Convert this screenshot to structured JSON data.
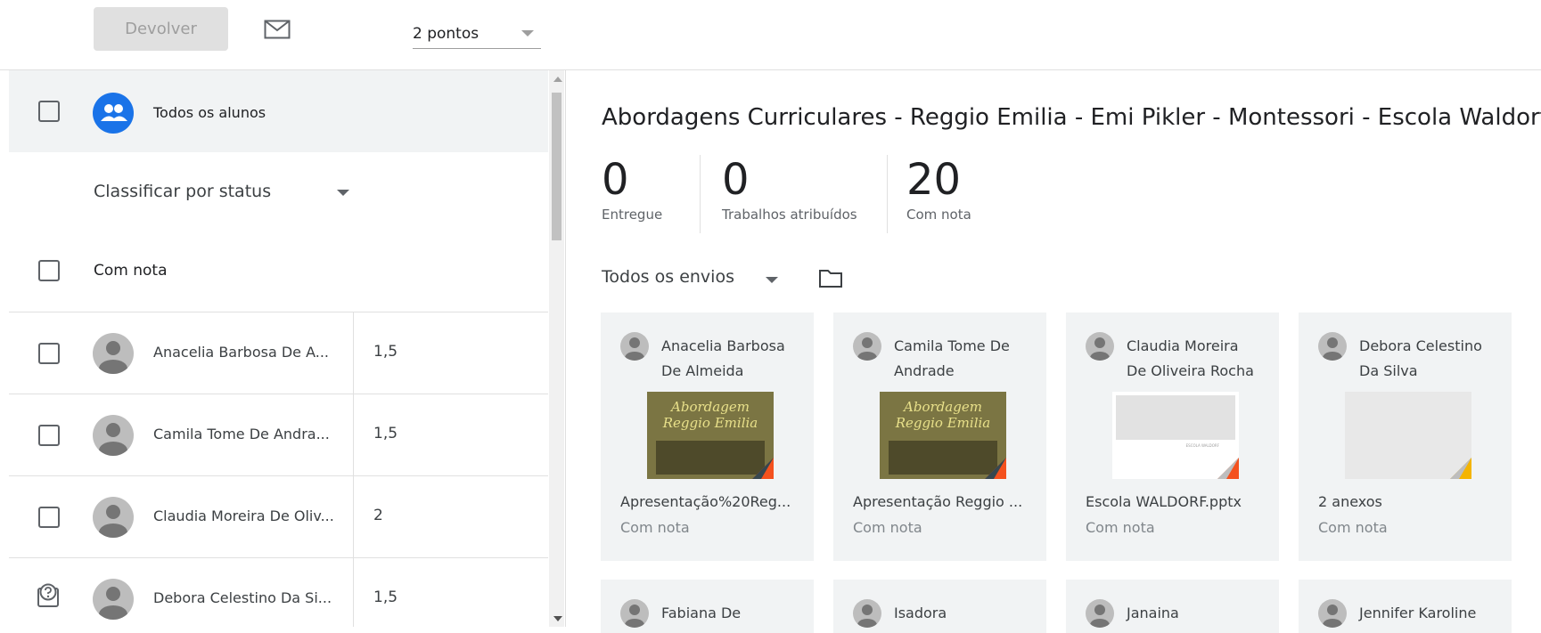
{
  "toolbar": {
    "return_label": "Devolver",
    "points_value": "2 pontos"
  },
  "left": {
    "all_students_label": "Todos os alunos",
    "sort_label": "Classificar por status",
    "group_label": "Com nota",
    "students": [
      {
        "name": "Anacelia Barbosa De A...",
        "grade": "1,5"
      },
      {
        "name": "Camila Tome De Andra...",
        "grade": "1,5"
      },
      {
        "name": "Claudia Moreira De Oliv...",
        "grade": "2"
      },
      {
        "name": "Debora Celestino Da Si...",
        "grade": "1,5"
      }
    ]
  },
  "right": {
    "title": "Abordagens Curriculares - Reggio Emilia - Emi Pikler - Montessori - Escola Waldorf",
    "stats": [
      {
        "value": "0",
        "label": "Entregue"
      },
      {
        "value": "0",
        "label": "Trabalhos atribuídos"
      },
      {
        "value": "20",
        "label": "Com nota"
      }
    ],
    "filter_label": "Todos os envios",
    "cards": [
      {
        "name_line1": "Anacelia Barbosa",
        "name_line2": "De Almeida",
        "file": "Apresentação%20Reg...",
        "status": "Com nota",
        "thumb_text1": "Abordagem",
        "thumb_text2": "Reggio Emilia"
      },
      {
        "name_line1": "Camila Tome De",
        "name_line2": "Andrade",
        "file": "Apresentação Reggio ...",
        "status": "Com nota",
        "thumb_text1": "Abordagem",
        "thumb_text2": "Reggio Emilia"
      },
      {
        "name_line1": "Claudia Moreira",
        "name_line2": "De Oliveira Rocha",
        "file": "Escola WALDORF.pptx",
        "status": "Com nota",
        "thumb_text1": "ESCOLA WALDORF"
      },
      {
        "name_line1": "Debora Celestino",
        "name_line2": "Da Silva",
        "file": "2 anexos",
        "status": "Com nota"
      }
    ],
    "cards_row2": [
      {
        "name": "Fabiana De"
      },
      {
        "name": "Isadora"
      },
      {
        "name": "Janaina"
      },
      {
        "name": "Jennifer Karoline"
      }
    ]
  },
  "colors": {
    "accent": "#1a73e8",
    "card_bg": "#f1f3f4",
    "button_disabled": "#e0e0e0",
    "thumb_orange": "#f4511e",
    "thumb_yellow": "#f4b400"
  },
  "icons": [
    "mail-icon",
    "people-icon",
    "person-avatar-icon",
    "help-icon",
    "folder-icon",
    "dropdown-caret-icon"
  ]
}
